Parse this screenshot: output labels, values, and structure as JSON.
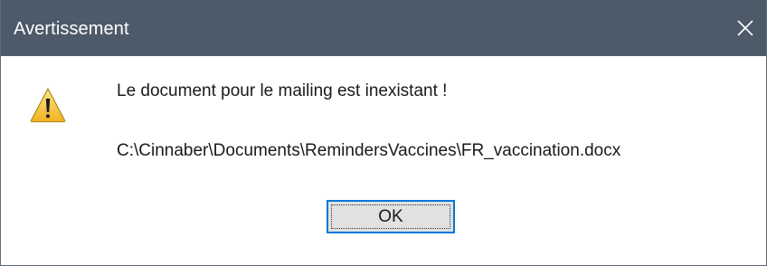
{
  "window": {
    "title": "Avertissement",
    "close_icon": "close-icon",
    "titlebar_color": "#4c5a6a"
  },
  "content": {
    "icon": "warning-icon",
    "message": "Le document pour le mailing est inexistant !",
    "path": "C:\\Cinnaber\\Documents\\RemindersVaccines\\FR_vaccination.docx"
  },
  "buttons": {
    "ok_label": "OK",
    "focus_color": "#0078d7"
  }
}
